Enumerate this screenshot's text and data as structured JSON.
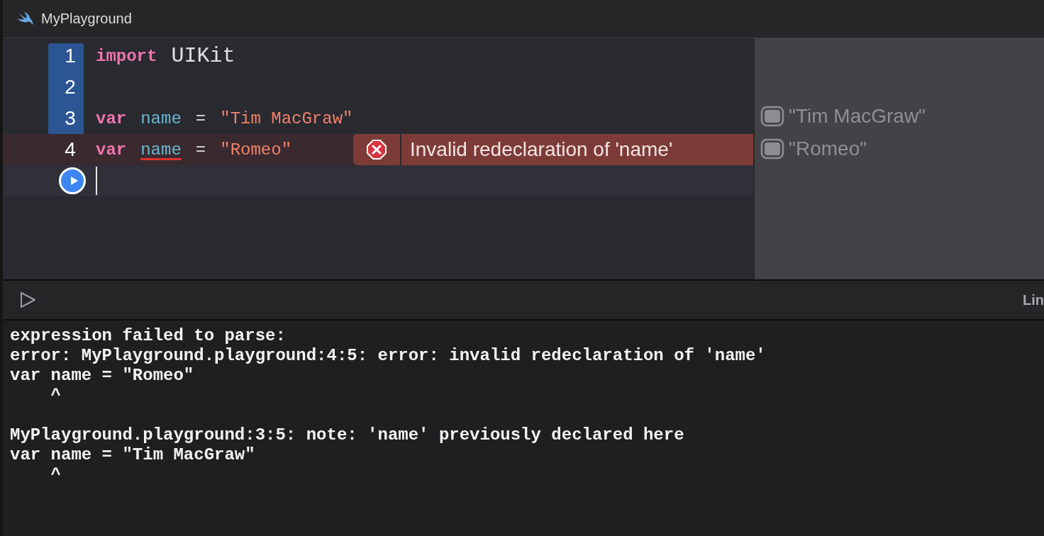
{
  "window": {
    "title": "MyPlayground"
  },
  "editor": {
    "lines": [
      {
        "number": "1",
        "error": false,
        "current": false,
        "run_here": false,
        "tokens": [
          {
            "kind": "keyword",
            "text": "import",
            "underlined": false
          },
          {
            "kind": "plain",
            "text": "UIKit",
            "underlined": false
          }
        ]
      },
      {
        "number": "2",
        "error": false,
        "current": false,
        "run_here": false
      },
      {
        "number": "3",
        "error": false,
        "current": false,
        "run_here": false,
        "tokens": [
          {
            "kind": "keyword",
            "text": "var",
            "underlined": false
          },
          {
            "kind": "identifier",
            "text": "name",
            "underlined": false
          },
          {
            "kind": "operator",
            "text": "=",
            "underlined": false
          },
          {
            "kind": "string",
            "text": "\"Tim MacGraw\"",
            "underlined": false
          }
        ]
      },
      {
        "number": "4",
        "error": true,
        "current": false,
        "run_here": false,
        "tokens": [
          {
            "kind": "keyword",
            "text": "var",
            "underlined": false
          },
          {
            "kind": "identifier",
            "text": "name",
            "underlined": true
          },
          {
            "kind": "operator",
            "text": "=",
            "underlined": false
          },
          {
            "kind": "string",
            "text": "\"Romeo\"",
            "underlined": false
          }
        ],
        "error_message": "Invalid redeclaration of 'name'"
      },
      {
        "error": false,
        "current": true,
        "run_here": true
      }
    ]
  },
  "results": [
    {
      "text": "\"Tim MacGraw\""
    },
    {
      "text": "\"Romeo\""
    }
  ],
  "debug_bar": {
    "right_label": "Lin"
  },
  "console": {
    "blocks": [
      [
        "expression failed to parse:",
        "error: MyPlayground.playground:4:5: error: invalid redeclaration of 'name'",
        "var name = \"Romeo\"",
        "    ^"
      ],
      [
        "MyPlayground.playground:3:5: note: 'name' previously declared here",
        "var name = \"Tim MacGraw\"",
        "    ^"
      ]
    ]
  }
}
